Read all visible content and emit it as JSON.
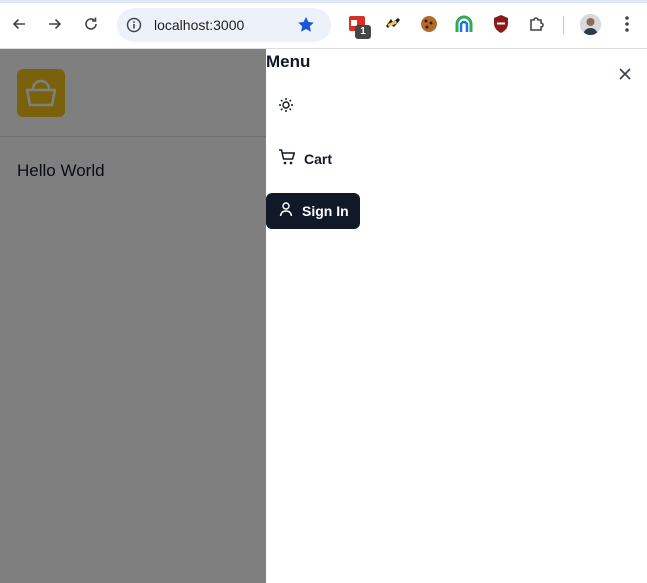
{
  "browser": {
    "url": "localhost:3000",
    "extension_badge": "1",
    "icons": [
      "back-arrow-icon",
      "forward-arrow-icon",
      "reload-icon",
      "site-info-icon",
      "bookmark-star-icon",
      "extension-icon",
      "extensions-puzzle-icon",
      "profile-avatar",
      "more-menu-icon"
    ],
    "accent_color": "#1a56db"
  },
  "page": {
    "greeting": "Hello World",
    "logo_icon": "shopping-bag-icon",
    "logo_color": "#f5c518"
  },
  "drawer": {
    "title": "Menu",
    "items": [
      {
        "icon": "sun-icon",
        "label": ""
      },
      {
        "icon": "shopping-cart-icon",
        "label": "Cart"
      },
      {
        "icon": "user-icon",
        "label": "Sign In"
      }
    ],
    "signin_bg": "#111827"
  }
}
